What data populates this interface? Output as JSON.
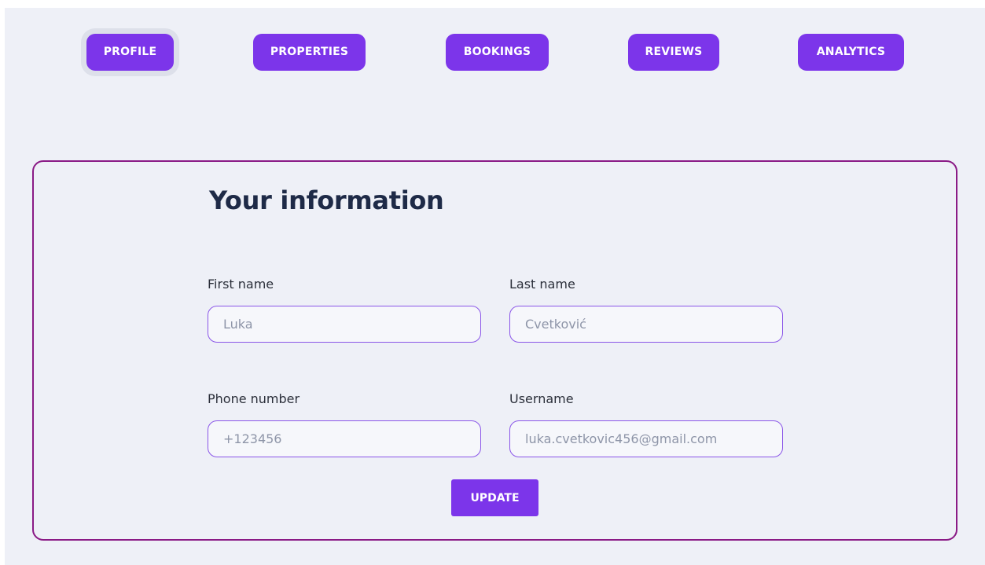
{
  "nav": {
    "tabs": [
      {
        "label": "PROFILE",
        "active": true
      },
      {
        "label": "PROPERTIES",
        "active": false
      },
      {
        "label": "BOOKINGS",
        "active": false
      },
      {
        "label": "REVIEWS",
        "active": false
      },
      {
        "label": "ANALYTICS",
        "active": false
      }
    ]
  },
  "form": {
    "title": "Your information",
    "first_name": {
      "label": "First name",
      "placeholder": "Luka"
    },
    "last_name": {
      "label": "Last name",
      "placeholder": "Cvetković"
    },
    "phone": {
      "label": "Phone number",
      "placeholder": "+123456"
    },
    "username": {
      "label": "Username",
      "placeholder": "luka.cvetkovic456@gmail.com"
    },
    "submit_label": "UPDATE"
  },
  "colors": {
    "accent": "#7c35ea",
    "card_border": "#8a1a86",
    "background": "#eef0f7",
    "title_text": "#1e2a47"
  }
}
